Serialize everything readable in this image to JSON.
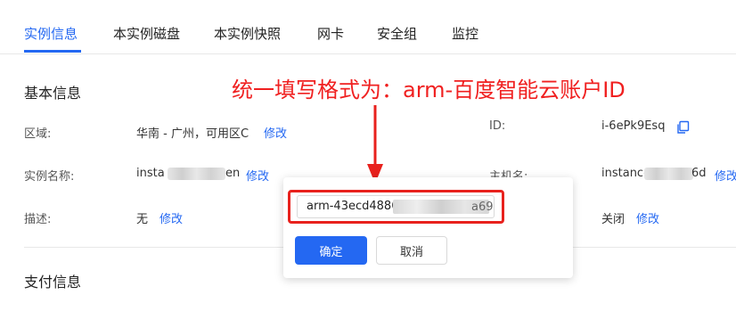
{
  "tabs": [
    "实例信息",
    "本实例磁盘",
    "本实例快照",
    "网卡",
    "安全组",
    "监控"
  ],
  "basic_info": {
    "title": "基本信息",
    "region_label": "区域:",
    "region_value": "华南 - 广州，可用区C",
    "instance_name_label": "实例名称:",
    "instance_name_prefix": "insta",
    "instance_name_suffix": "en",
    "description_label": "描述:",
    "description_value": "无",
    "edit_label": "修改",
    "id_label": "ID:",
    "id_value": "i-6ePk9Esq",
    "hostname_label": "主机名:",
    "hostname_prefix": "instance",
    "hostname_suffix": "6d",
    "right_row3_value": "关闭"
  },
  "payment_info": {
    "title": "支付信息"
  },
  "annotation": {
    "text": "统一填写格式为：arm-百度智能云账户ID",
    "color": "#f02020"
  },
  "popover": {
    "input_value": "arm-43ecd4886",
    "input_trailing": "a69",
    "confirm_label": "确定",
    "cancel_label": "取消"
  },
  "colors": {
    "accent": "#2468f2",
    "highlight": "#e8211d"
  },
  "icons": {
    "copy": "copy-icon",
    "arrow": "arrow-down-icon"
  }
}
